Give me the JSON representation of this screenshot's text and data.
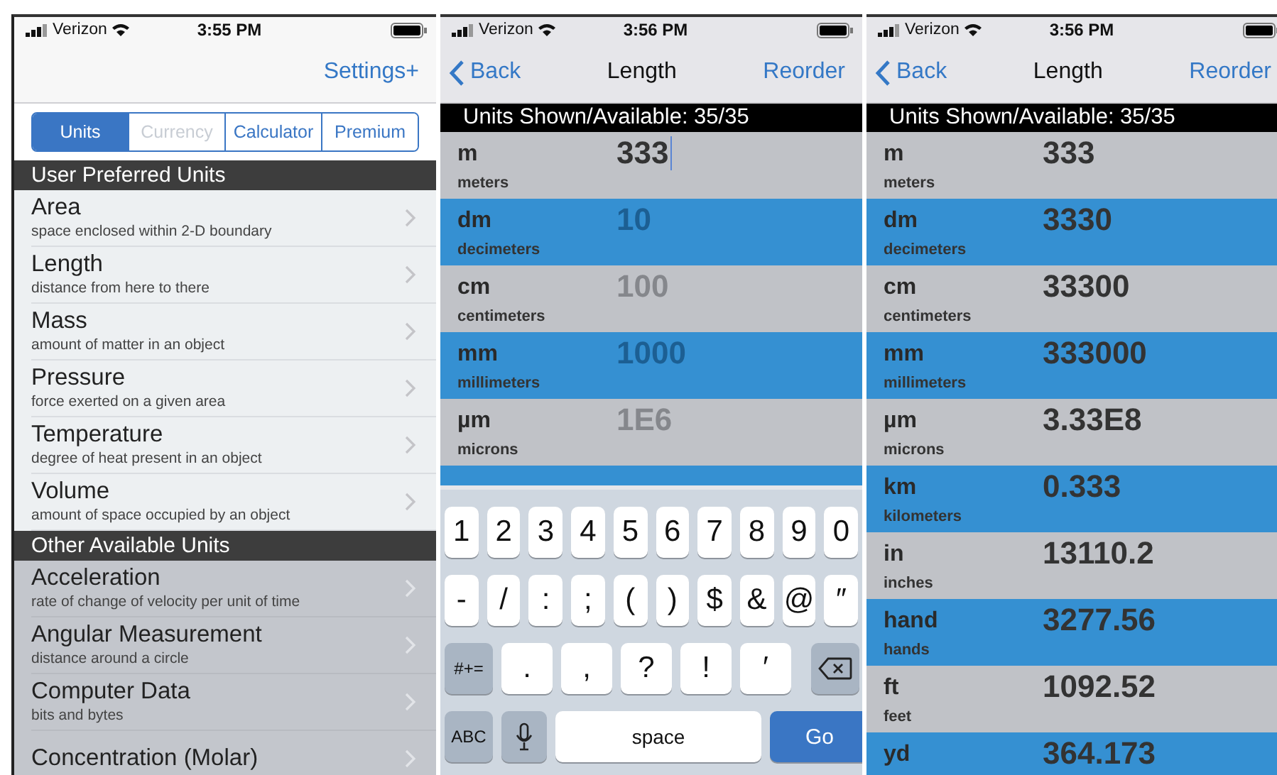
{
  "screens": [
    {
      "kind": "menu",
      "status": {
        "carrier": "Verizon",
        "time": "3:55 PM"
      },
      "nav": {
        "action": "Settings+"
      },
      "segments": [
        {
          "label": "Units",
          "selected": true,
          "disabled": false
        },
        {
          "label": "Currency",
          "selected": false,
          "disabled": true
        },
        {
          "label": "Calculator",
          "selected": false,
          "disabled": false
        },
        {
          "label": "Premium",
          "selected": false,
          "disabled": false
        }
      ],
      "sections": [
        {
          "title": "User Preferred Units",
          "dimmed": false,
          "items": [
            {
              "name": "Area",
              "description": "space enclosed within 2-D boundary"
            },
            {
              "name": "Length",
              "description": "distance from here to there"
            },
            {
              "name": "Mass",
              "description": "amount of matter in an object"
            },
            {
              "name": "Pressure",
              "description": "force exerted on a given area"
            },
            {
              "name": "Temperature",
              "description": "degree of heat present in an object"
            },
            {
              "name": "Volume",
              "description": "amount of space occupied by an object"
            }
          ]
        },
        {
          "title": "Other Available Units",
          "dimmed": true,
          "items": [
            {
              "name": "Acceleration",
              "description": "rate of change of velocity per unit of time"
            },
            {
              "name": "Angular Measurement",
              "description": "distance around a circle"
            },
            {
              "name": "Computer Data",
              "description": "bits and bytes"
            },
            {
              "name": "Concentration (Molar)"
            }
          ]
        }
      ]
    },
    {
      "kind": "converter",
      "status": {
        "carrier": "Verizon",
        "time": "3:56 PM"
      },
      "nav": {
        "back": "Back",
        "title": "Length",
        "action": "Reorder"
      },
      "header": "Units Shown/Available: 35/35",
      "rows": [
        {
          "abbr": "m",
          "name": "meters",
          "value": "333",
          "focused": true
        },
        {
          "abbr": "dm",
          "name": "decimeters",
          "placeholder": "10"
        },
        {
          "abbr": "cm",
          "name": "centimeters",
          "placeholder": "100"
        },
        {
          "abbr": "mm",
          "name": "millimeters",
          "placeholder": "1000"
        },
        {
          "abbr": "µm",
          "name": "microns",
          "placeholder": "1E6"
        }
      ],
      "keyboard": [
        [
          {
            "kind": "char",
            "label": "1"
          },
          {
            "kind": "char",
            "label": "2"
          },
          {
            "kind": "char",
            "label": "3"
          },
          {
            "kind": "char",
            "label": "4"
          },
          {
            "kind": "char",
            "label": "5"
          },
          {
            "kind": "char",
            "label": "6"
          },
          {
            "kind": "char",
            "label": "7"
          },
          {
            "kind": "char",
            "label": "8"
          },
          {
            "kind": "char",
            "label": "9"
          },
          {
            "kind": "char",
            "label": "0"
          }
        ],
        [
          {
            "kind": "char",
            "label": "-"
          },
          {
            "kind": "char",
            "label": "/"
          },
          {
            "kind": "char",
            "label": ":"
          },
          {
            "kind": "char",
            "label": ";"
          },
          {
            "kind": "char",
            "label": "("
          },
          {
            "kind": "char",
            "label": ")"
          },
          {
            "kind": "char",
            "label": "$"
          },
          {
            "kind": "char",
            "label": "&"
          },
          {
            "kind": "char",
            "label": "@"
          },
          {
            "kind": "char",
            "label": "″"
          }
        ],
        [
          {
            "kind": "mode",
            "label": "#+="
          },
          {
            "kind": "wide",
            "label": "."
          },
          {
            "kind": "wide",
            "label": ","
          },
          {
            "kind": "wide",
            "label": "?"
          },
          {
            "kind": "wide",
            "label": "!"
          },
          {
            "kind": "wide",
            "label": "′"
          },
          {
            "kind": "delete"
          }
        ],
        [
          {
            "kind": "mode",
            "label": "ABC"
          },
          {
            "kind": "mic"
          },
          {
            "kind": "space",
            "label": "space"
          },
          {
            "kind": "go",
            "label": "Go"
          }
        ]
      ]
    },
    {
      "kind": "converter",
      "status": {
        "carrier": "Verizon",
        "time": "3:56 PM"
      },
      "nav": {
        "back": "Back",
        "title": "Length",
        "action": "Reorder"
      },
      "header": "Units Shown/Available: 35/35",
      "rows": [
        {
          "abbr": "m",
          "name": "meters",
          "value": "333"
        },
        {
          "abbr": "dm",
          "name": "decimeters",
          "value": "3330"
        },
        {
          "abbr": "cm",
          "name": "centimeters",
          "value": "33300"
        },
        {
          "abbr": "mm",
          "name": "millimeters",
          "value": "333000"
        },
        {
          "abbr": "µm",
          "name": "microns",
          "value": "3.33E8"
        },
        {
          "abbr": "km",
          "name": "kilometers",
          "value": "0.333"
        },
        {
          "abbr": "in",
          "name": "inches",
          "value": "13110.2"
        },
        {
          "abbr": "hand",
          "name": "hands",
          "value": "3277.56"
        },
        {
          "abbr": "ft",
          "name": "feet",
          "value": "1092.52"
        },
        {
          "abbr": "yd",
          "value": "364.173"
        }
      ]
    }
  ]
}
